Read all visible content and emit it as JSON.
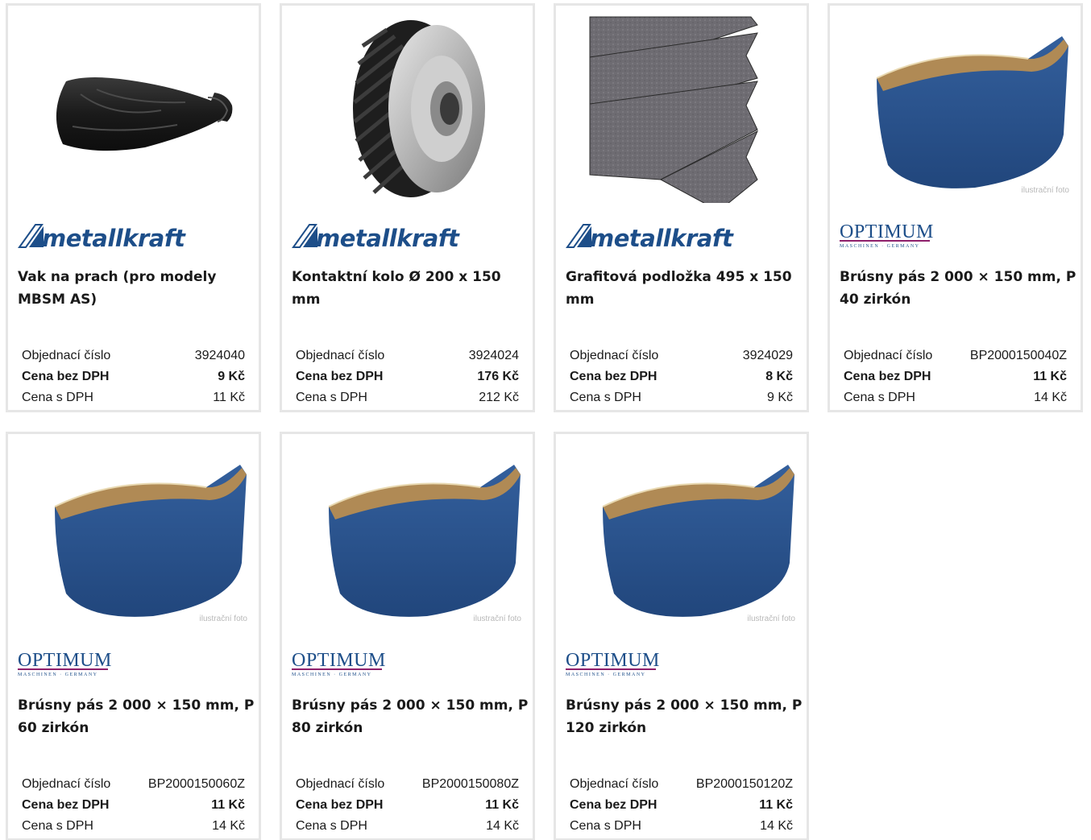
{
  "products": [
    {
      "brand": "metallkraft",
      "image": "dust-bag",
      "title": "Vak na prach (pro modely MBSM AS)",
      "order_label": "Objednací číslo",
      "order_no": "3924040",
      "price_net_label": "Cena bez DPH",
      "price_net": "9 Kč",
      "price_gross_label": "Cena s DPH",
      "price_gross": "11 Kč"
    },
    {
      "brand": "metallkraft",
      "image": "contact-wheel",
      "title": "Kontaktní kolo Ø 200 x 150 mm",
      "order_label": "Objednací číslo",
      "order_no": "3924024",
      "price_net_label": "Cena bez DPH",
      "price_net": "176 Kč",
      "price_gross_label": "Cena s DPH",
      "price_gross": "212 Kč"
    },
    {
      "brand": "metallkraft",
      "image": "graphite-pad",
      "title": "Grafitová podložka 495 x 150 mm",
      "order_label": "Objednací číslo",
      "order_no": "3924029",
      "price_net_label": "Cena bez DPH",
      "price_net": "8 Kč",
      "price_gross_label": "Cena s DPH",
      "price_gross": "9 Kč"
    },
    {
      "brand": "OPTIMUM",
      "image": "sanding-belt",
      "illustration_note": "ilustrační foto",
      "title": "Brúsny pás 2 000 × 150 mm, P 40 zirkón",
      "order_label": "Objednací číslo",
      "order_no": "BP2000150040Z",
      "price_net_label": "Cena bez DPH",
      "price_net": "11 Kč",
      "price_gross_label": "Cena s DPH",
      "price_gross": "14 Kč"
    },
    {
      "brand": "OPTIMUM",
      "image": "sanding-belt",
      "illustration_note": "ilustrační foto",
      "title": "Brúsny pás 2 000 × 150 mm, P 60 zirkón",
      "order_label": "Objednací číslo",
      "order_no": "BP2000150060Z",
      "price_net_label": "Cena bez DPH",
      "price_net": "11 Kč",
      "price_gross_label": "Cena s DPH",
      "price_gross": "14 Kč"
    },
    {
      "brand": "OPTIMUM",
      "image": "sanding-belt",
      "illustration_note": "ilustrační foto",
      "title": "Brúsny pás 2 000 × 150 mm, P 80 zirkón",
      "order_label": "Objednací číslo",
      "order_no": "BP2000150080Z",
      "price_net_label": "Cena bez DPH",
      "price_net": "11 Kč",
      "price_gross_label": "Cena s DPH",
      "price_gross": "14 Kč"
    },
    {
      "brand": "OPTIMUM",
      "image": "sanding-belt",
      "illustration_note": "ilustrační foto",
      "title": "Brúsny pás 2 000 × 150 mm, P 120 zirkón",
      "order_label": "Objednací číslo",
      "order_no": "BP2000150120Z",
      "price_net_label": "Cena bez DPH",
      "price_net": "11 Kč",
      "price_gross_label": "Cena s DPH",
      "price_gross": "14 Kč"
    }
  ],
  "brand_logos": {
    "metallkraft": {
      "text": "metallkraft",
      "color": "#1d4e89"
    },
    "OPTIMUM": {
      "text": "OPTIMUM",
      "sub": "MASCHINEN · GERMANY",
      "color": "#1d4e89",
      "accent": "#8e1f6b"
    }
  },
  "colors": {
    "card_border": "#e6e6e6",
    "text": "#1a1a1a",
    "belt_blue": "#2a5796"
  }
}
